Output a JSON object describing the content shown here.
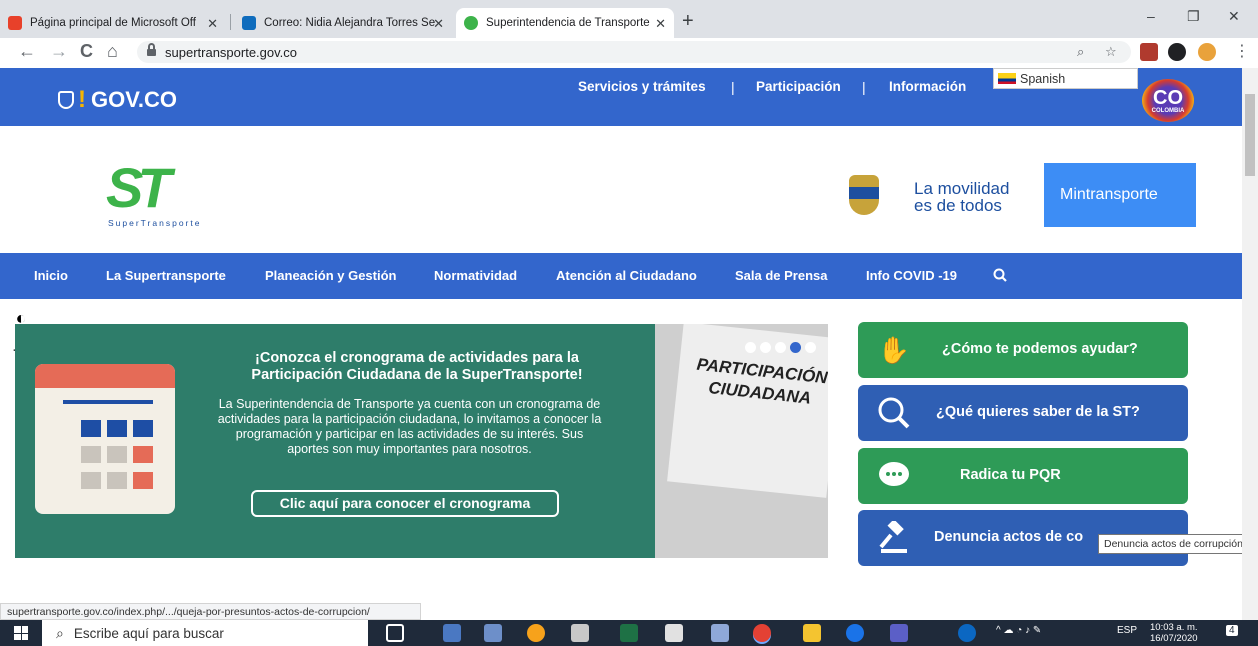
{
  "browser": {
    "tabs": [
      {
        "title": "Página principal de Microsoft Off",
        "close": "✕",
        "color": "#e8412a"
      },
      {
        "title": "Correo: Nidia Alejandra Torres Se",
        "close": "✕",
        "color": "#0f6cbd"
      },
      {
        "title": "Superintendencia de Transporte",
        "close": "✕",
        "color": "#3db34a"
      }
    ],
    "new_tab": "+",
    "window_controls": {
      "minimize": "–",
      "maximize": "❐",
      "close": "✕"
    },
    "url": "supertransporte.gov.co",
    "nav": {
      "back": "←",
      "forward": "→",
      "reload": "C",
      "home": "⌂"
    },
    "omni_icons": {
      "zoom": "⌕",
      "star": "☆"
    },
    "ext_icons": [
      "acrobat-icon",
      "puzzle-icon",
      "profile-avatar"
    ],
    "menu": "⋮"
  },
  "gov_header": {
    "logo": "GOV.CO",
    "nav": [
      "Servicios y trámites",
      "Participación",
      "Información"
    ],
    "separator": "|",
    "language": "Spanish",
    "badge_main": "CO",
    "badge_sub": "COLOMBIA"
  },
  "brand": {
    "logo_big": "ST",
    "logo_sub": "SuperTransporte",
    "mint_slogan_line1": "La movilidad",
    "mint_slogan_line2": "es de todos",
    "mint_name": "Mintransporte"
  },
  "main_nav": [
    "Inicio",
    "La Supertransporte",
    "Planeación y Gestión",
    "Normatividad",
    "Atención al Ciudadano",
    "Sala de Prensa",
    "Info COVID -19"
  ],
  "accessibility": {
    "contrast": "◐",
    "text_size": "тT"
  },
  "banner": {
    "heading": "¡Conozca el cronograma de actividades para la Participación Ciudadana de la SuperTransporte!",
    "body": "La Superintendencia de Transporte ya cuenta con un cronograma de actividades para la participación ciudadana, lo invitamos a conocer la programación y participar en las actividades de su interés. Sus aportes son muy importantes para nosotros.",
    "cta": "Clic aquí para conocer el cronograma",
    "laptop_text": "PARTICIPACIÓN CIUDADANA",
    "slides": 5,
    "active_slide": 4
  },
  "quick_links": [
    {
      "label": "¿Cómo te podemos ayudar?",
      "icon": "hand-wave-icon",
      "color": "#2e9b57"
    },
    {
      "label": "¿Qué quieres saber de la ST?",
      "icon": "globe-search-icon",
      "color": "#2f5fb4"
    },
    {
      "label": "Radica tu PQR",
      "icon": "chat-bubble-icon",
      "color": "#2e9b57"
    },
    {
      "label": "Denuncia actos de co",
      "icon": "gavel-icon",
      "color": "#2f5fb4"
    }
  ],
  "tooltip": "Denuncia actos de corrupción",
  "status_url": "supertransporte.gov.co/index.php/.../queja-por-presuntos-actos-de-corrupcion/",
  "taskbar": {
    "search_placeholder": "Escribe aquí para buscar",
    "language": "ESP",
    "time": "10:03 a. m.",
    "date": "16/07/2020",
    "notifications": "4"
  },
  "colors": {
    "gov_blue": "#3366cc",
    "st_green": "#3db34a",
    "mint_blue": "#3d8df5",
    "banner_teal": "#2e7d6a"
  }
}
